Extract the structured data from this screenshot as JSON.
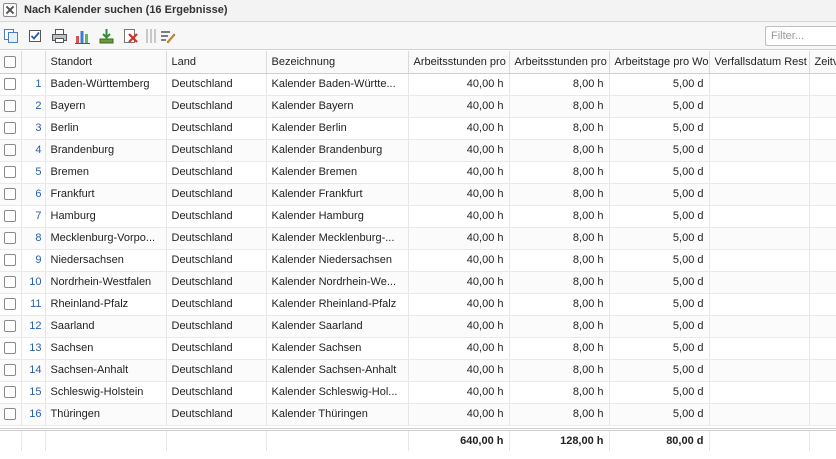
{
  "window": {
    "title": "Nach Kalender suchen (16 Ergebnisse)"
  },
  "toolbar": {
    "filter_placeholder": "Filter...",
    "filter_value": ""
  },
  "grid": {
    "columns": [
      "Standort",
      "Land",
      "Bezeichnung",
      "Arbeitsstunden pro",
      "Arbeitsstunden pro",
      "Arbeitstage pro Wo",
      "Verfallsdatum Rest",
      "Zeitv"
    ],
    "rows": [
      {
        "nr": "1",
        "standort": "Baden-Württemberg",
        "land": "Deutschland",
        "bezeichnung": "Kalender Baden-Württe...",
        "h1": "40,00 h",
        "h2": "8,00 h",
        "d": "5,00 d"
      },
      {
        "nr": "2",
        "standort": "Bayern",
        "land": "Deutschland",
        "bezeichnung": "Kalender Bayern",
        "h1": "40,00 h",
        "h2": "8,00 h",
        "d": "5,00 d"
      },
      {
        "nr": "3",
        "standort": "Berlin",
        "land": "Deutschland",
        "bezeichnung": "Kalender Berlin",
        "h1": "40,00 h",
        "h2": "8,00 h",
        "d": "5,00 d"
      },
      {
        "nr": "4",
        "standort": "Brandenburg",
        "land": "Deutschland",
        "bezeichnung": "Kalender Brandenburg",
        "h1": "40,00 h",
        "h2": "8,00 h",
        "d": "5,00 d"
      },
      {
        "nr": "5",
        "standort": "Bremen",
        "land": "Deutschland",
        "bezeichnung": "Kalender Bremen",
        "h1": "40,00 h",
        "h2": "8,00 h",
        "d": "5,00 d"
      },
      {
        "nr": "6",
        "standort": "Frankfurt",
        "land": "Deutschland",
        "bezeichnung": "Kalender Frankfurt",
        "h1": "40,00 h",
        "h2": "8,00 h",
        "d": "5,00 d"
      },
      {
        "nr": "7",
        "standort": "Hamburg",
        "land": "Deutschland",
        "bezeichnung": "Kalender Hamburg",
        "h1": "40,00 h",
        "h2": "8,00 h",
        "d": "5,00 d"
      },
      {
        "nr": "8",
        "standort": "Mecklenburg-Vorpo...",
        "land": "Deutschland",
        "bezeichnung": "Kalender Mecklenburg-...",
        "h1": "40,00 h",
        "h2": "8,00 h",
        "d": "5,00 d"
      },
      {
        "nr": "9",
        "standort": "Niedersachsen",
        "land": "Deutschland",
        "bezeichnung": "Kalender Niedersachsen",
        "h1": "40,00 h",
        "h2": "8,00 h",
        "d": "5,00 d"
      },
      {
        "nr": "10",
        "standort": "Nordrhein-Westfalen",
        "land": "Deutschland",
        "bezeichnung": "Kalender Nordrhein-We...",
        "h1": "40,00 h",
        "h2": "8,00 h",
        "d": "5,00 d"
      },
      {
        "nr": "11",
        "standort": "Rheinland-Pfalz",
        "land": "Deutschland",
        "bezeichnung": "Kalender Rheinland-Pfalz",
        "h1": "40,00 h",
        "h2": "8,00 h",
        "d": "5,00 d"
      },
      {
        "nr": "12",
        "standort": "Saarland",
        "land": "Deutschland",
        "bezeichnung": "Kalender Saarland",
        "h1": "40,00 h",
        "h2": "8,00 h",
        "d": "5,00 d"
      },
      {
        "nr": "13",
        "standort": "Sachsen",
        "land": "Deutschland",
        "bezeichnung": "Kalender Sachsen",
        "h1": "40,00 h",
        "h2": "8,00 h",
        "d": "5,00 d"
      },
      {
        "nr": "14",
        "standort": "Sachsen-Anhalt",
        "land": "Deutschland",
        "bezeichnung": "Kalender Sachsen-Anhalt",
        "h1": "40,00 h",
        "h2": "8,00 h",
        "d": "5,00 d"
      },
      {
        "nr": "15",
        "standort": "Schleswig-Holstein",
        "land": "Deutschland",
        "bezeichnung": "Kalender Schleswig-Hol...",
        "h1": "40,00 h",
        "h2": "8,00 h",
        "d": "5,00 d"
      },
      {
        "nr": "16",
        "standort": "Thüringen",
        "land": "Deutschland",
        "bezeichnung": "Kalender Thüringen",
        "h1": "40,00 h",
        "h2": "8,00 h",
        "d": "5,00 d"
      }
    ],
    "totals": {
      "h1": "640,00 h",
      "h2": "128,00 h",
      "d": "80,00 d"
    }
  }
}
